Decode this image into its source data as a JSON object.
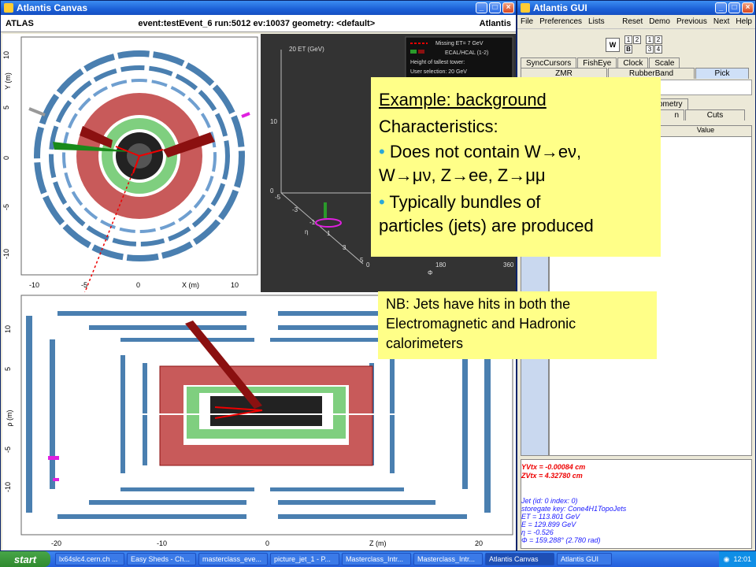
{
  "canvas_window": {
    "title": "Atlantis Canvas",
    "header_left": "ATLAS",
    "header_center": "event:testEvent_6 run:5012 ev:10037 geometry: <default>",
    "header_right": "Atlantis"
  },
  "xy_view": {
    "y_axis_label": "Y (m)",
    "x_axis_label": "X (m)",
    "y_ticks": [
      "10",
      "5",
      "0",
      "-5",
      "-10"
    ],
    "x_ticks": [
      "-10",
      "-5",
      "0",
      "5",
      "10"
    ]
  },
  "lego_view": {
    "et_axis_label": "20 ET (GeV)",
    "et_ticks": [
      "10",
      "0"
    ],
    "eta_label": "η",
    "phi_label": "Φ",
    "eta_ticks": [
      "-5",
      "-3",
      "-1",
      "1",
      "3",
      "5"
    ],
    "phi_ticks": [
      "0",
      "180",
      "360"
    ],
    "legend": {
      "missing_et": "Missing ET= 7 GeV",
      "ecal_hcal": "ECAL/HCAL (1-2)",
      "tallest": "Height of tallest tower:",
      "selection": "User selection: 20 GeV"
    }
  },
  "rz_view": {
    "y_axis_label": "ρ (m)",
    "x_axis_label": "Z (m)",
    "y_ticks": [
      "10",
      "5",
      "0",
      "-5",
      "-10"
    ],
    "x_ticks": [
      "-20",
      "-10",
      "0",
      "10",
      "20"
    ]
  },
  "gui_window": {
    "title": "Atlantis GUI",
    "menu_left": [
      "File",
      "Preferences",
      "Lists"
    ],
    "menu_right": [
      "Reset",
      "Demo",
      "Previous",
      "Next",
      "Help"
    ],
    "w_button": "W",
    "grid_a": [
      "1",
      "2",
      "B",
      ""
    ],
    "grid_b": [
      "1",
      "2",
      "3",
      "4"
    ],
    "tabs_row1": [
      "SyncCursors",
      "FishEye",
      "Clock",
      "Scale"
    ],
    "tabs_row2": [
      "ZMR",
      "RubberBand",
      "Pick"
    ],
    "tabs_row3": [
      "ometry"
    ],
    "tabs_row4": [
      "n",
      "Cuts"
    ],
    "table_header_value": "Value",
    "output_lines": [
      "YVtx = -0.00084 cm",
      "ZVtx = 4.32780 cm"
    ],
    "jet_info": [
      "Jet (id: 0 index: 0)",
      " storegate key: Cone4H1TopoJets",
      " ET  = 113.801 GeV",
      " E   = 129.899 GeV",
      " η = -0.526",
      " Φ = 159.288°  (2.780 rad)"
    ]
  },
  "slide_box_main": {
    "heading": "Example: background",
    "subheading": "Characteristics:",
    "bullet1_line1": "Does not contain W→eν,",
    "bullet1_line2": "W→μν, Z→ee, Z→μμ",
    "bullet2_line1": "Typically bundles of",
    "bullet2_line2": "particles (jets) are produced"
  },
  "slide_box_note": {
    "text": "NB: Jets have hits in both the Electromagnetic and Hadronic calorimeters"
  },
  "taskbar": {
    "start": "start",
    "tasks": [
      "lx64slc4.cern.ch ...",
      "Easy Sheds - Ch...",
      "masterclass_eve...",
      "picture_jet_1 - P...",
      "Masterclass_Intr...",
      "Masterclass_Intr...",
      "Atlantis Canvas",
      "Atlantis GUI"
    ],
    "clock": "12:01"
  },
  "colors": {
    "slide_yellow": "#ffff88",
    "bullet_cyan": "#2aa8d8",
    "calo_red": "#c85a5a",
    "ecal_green": "#7fcf7f",
    "muon_blue": "#4a7fb0",
    "jet_darkred": "#8b1010"
  }
}
